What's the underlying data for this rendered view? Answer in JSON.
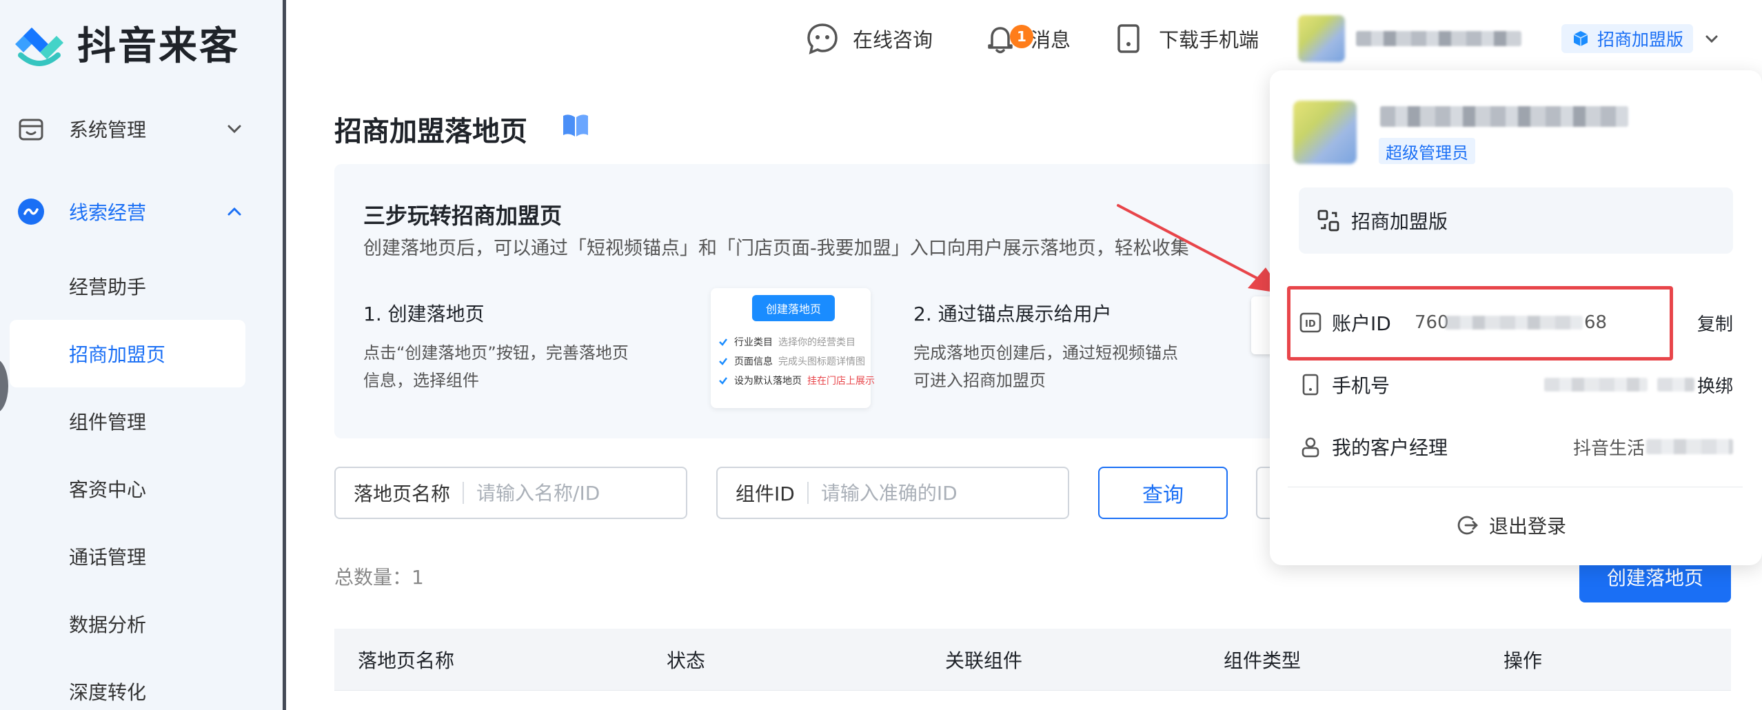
{
  "brand": {
    "name": "抖音来客"
  },
  "sidebar": {
    "groups": [
      {
        "label": "系统管理",
        "icon": "store-icon",
        "expanded": false
      },
      {
        "label": "线索经营",
        "icon": "leads-icon",
        "expanded": true
      }
    ],
    "sub_items": [
      {
        "label": "经营助手"
      },
      {
        "label": "招商加盟页",
        "selected": true
      },
      {
        "label": "组件管理"
      },
      {
        "label": "客资中心"
      },
      {
        "label": "通话管理"
      },
      {
        "label": "数据分析"
      },
      {
        "label": "深度转化"
      }
    ]
  },
  "header": {
    "consult": "在线咨询",
    "messages": "消息",
    "message_badge": "1",
    "download": "下载手机端",
    "plan": "招商加盟版"
  },
  "page": {
    "title": "招商加盟落地页",
    "guide": {
      "title": "三步玩转招商加盟页",
      "desc": "创建落地页后，可以通过「短视频锚点」和「门店页面-我要加盟」入口向用户展示落地页，轻松收集",
      "step1_title": "1. 创建落地页",
      "step1_desc": "点击“创建落地页”按钮，完善落地页信息，选择组件",
      "step2_title": "2. 通过锚点展示给用户",
      "step2_desc": "完成落地页创建后，通过短视频锚点可进入招商加盟页",
      "mock_button": "创建落地页",
      "mock_rows": [
        {
          "label": "行业类目",
          "sub": "选择你的经营类目"
        },
        {
          "label": "页面信息",
          "sub": "完成头图标题详情图"
        },
        {
          "label": "设为默认落地页",
          "sub": "挂在门店上展示"
        }
      ]
    },
    "filters": {
      "name_label": "落地页名称",
      "name_placeholder": "请输入名称/ID",
      "component_label": "组件ID",
      "component_placeholder": "请输入准确的ID",
      "query": "查询"
    },
    "total": "总数量：1",
    "create": "创建落地页",
    "table_headers": [
      "落地页名称",
      "状态",
      "关联组件",
      "组件类型",
      "操作"
    ]
  },
  "dropdown": {
    "role": "超级管理员",
    "plan": "招商加盟版",
    "account_label": "账户ID",
    "account_prefix": "760",
    "account_suffix": "68",
    "copy": "复制",
    "phone_label": "手机号",
    "rebind": "换绑",
    "manager_label": "我的客户经理",
    "manager_value": "抖音生活",
    "logout": "退出登录"
  },
  "colors": {
    "accent": "#1a6ff5",
    "highlight": "#e8454a",
    "badge": "#ff7d1a"
  }
}
